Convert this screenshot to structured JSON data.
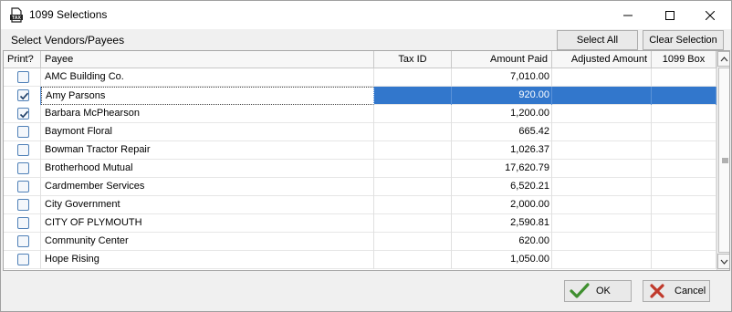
{
  "window": {
    "title": "1099 Selections",
    "app_icon": "tax-document-icon",
    "controls": [
      "minimize-icon",
      "maximize-icon",
      "close-icon"
    ]
  },
  "section": {
    "title": "Select Vendors/Payees",
    "select_all_label": "Select All",
    "clear_selection_label": "Clear Selection"
  },
  "grid": {
    "columns": {
      "print": "Print?",
      "payee": "Payee",
      "tax_id": "Tax ID",
      "amount_paid": "Amount Paid",
      "adjusted_amount": "Adjusted Amount",
      "box_1099": "1099 Box"
    },
    "rows": [
      {
        "print": false,
        "payee": "AMC Building Co.",
        "tax_id": "",
        "amount_paid": "7,010.00",
        "adjusted_amount": "",
        "box_1099": ""
      },
      {
        "print": true,
        "payee": "Amy Parsons",
        "tax_id": "",
        "amount_paid": "920.00",
        "adjusted_amount": "",
        "box_1099": "",
        "selected": true
      },
      {
        "print": true,
        "payee": "Barbara McPhearson",
        "tax_id": "",
        "amount_paid": "1,200.00",
        "adjusted_amount": "",
        "box_1099": ""
      },
      {
        "print": false,
        "payee": "Baymont Floral",
        "tax_id": "",
        "amount_paid": "665.42",
        "adjusted_amount": "",
        "box_1099": ""
      },
      {
        "print": false,
        "payee": "Bowman Tractor Repair",
        "tax_id": "",
        "amount_paid": "1,026.37",
        "adjusted_amount": "",
        "box_1099": ""
      },
      {
        "print": false,
        "payee": "Brotherhood Mutual",
        "tax_id": "",
        "amount_paid": "17,620.79",
        "adjusted_amount": "",
        "box_1099": ""
      },
      {
        "print": false,
        "payee": "Cardmember Services",
        "tax_id": "",
        "amount_paid": "6,520.21",
        "adjusted_amount": "",
        "box_1099": ""
      },
      {
        "print": false,
        "payee": "City Government",
        "tax_id": "",
        "amount_paid": "2,000.00",
        "adjusted_amount": "",
        "box_1099": ""
      },
      {
        "print": false,
        "payee": "CITY OF PLYMOUTH",
        "tax_id": "",
        "amount_paid": "2,590.81",
        "adjusted_amount": "",
        "box_1099": ""
      },
      {
        "print": false,
        "payee": "Community Center",
        "tax_id": "",
        "amount_paid": "620.00",
        "adjusted_amount": "",
        "box_1099": ""
      },
      {
        "print": false,
        "payee": "Hope Rising",
        "tax_id": "",
        "amount_paid": "1,050.00",
        "adjusted_amount": "",
        "box_1099": ""
      }
    ]
  },
  "footer": {
    "ok_label": "OK",
    "ok_icon": "checkmark-icon",
    "cancel_label": "Cancel",
    "cancel_icon": "x-icon"
  },
  "colors": {
    "selection": "#3277cc",
    "ok_check": "#3f8f2f",
    "cancel_x": "#c0392b"
  }
}
